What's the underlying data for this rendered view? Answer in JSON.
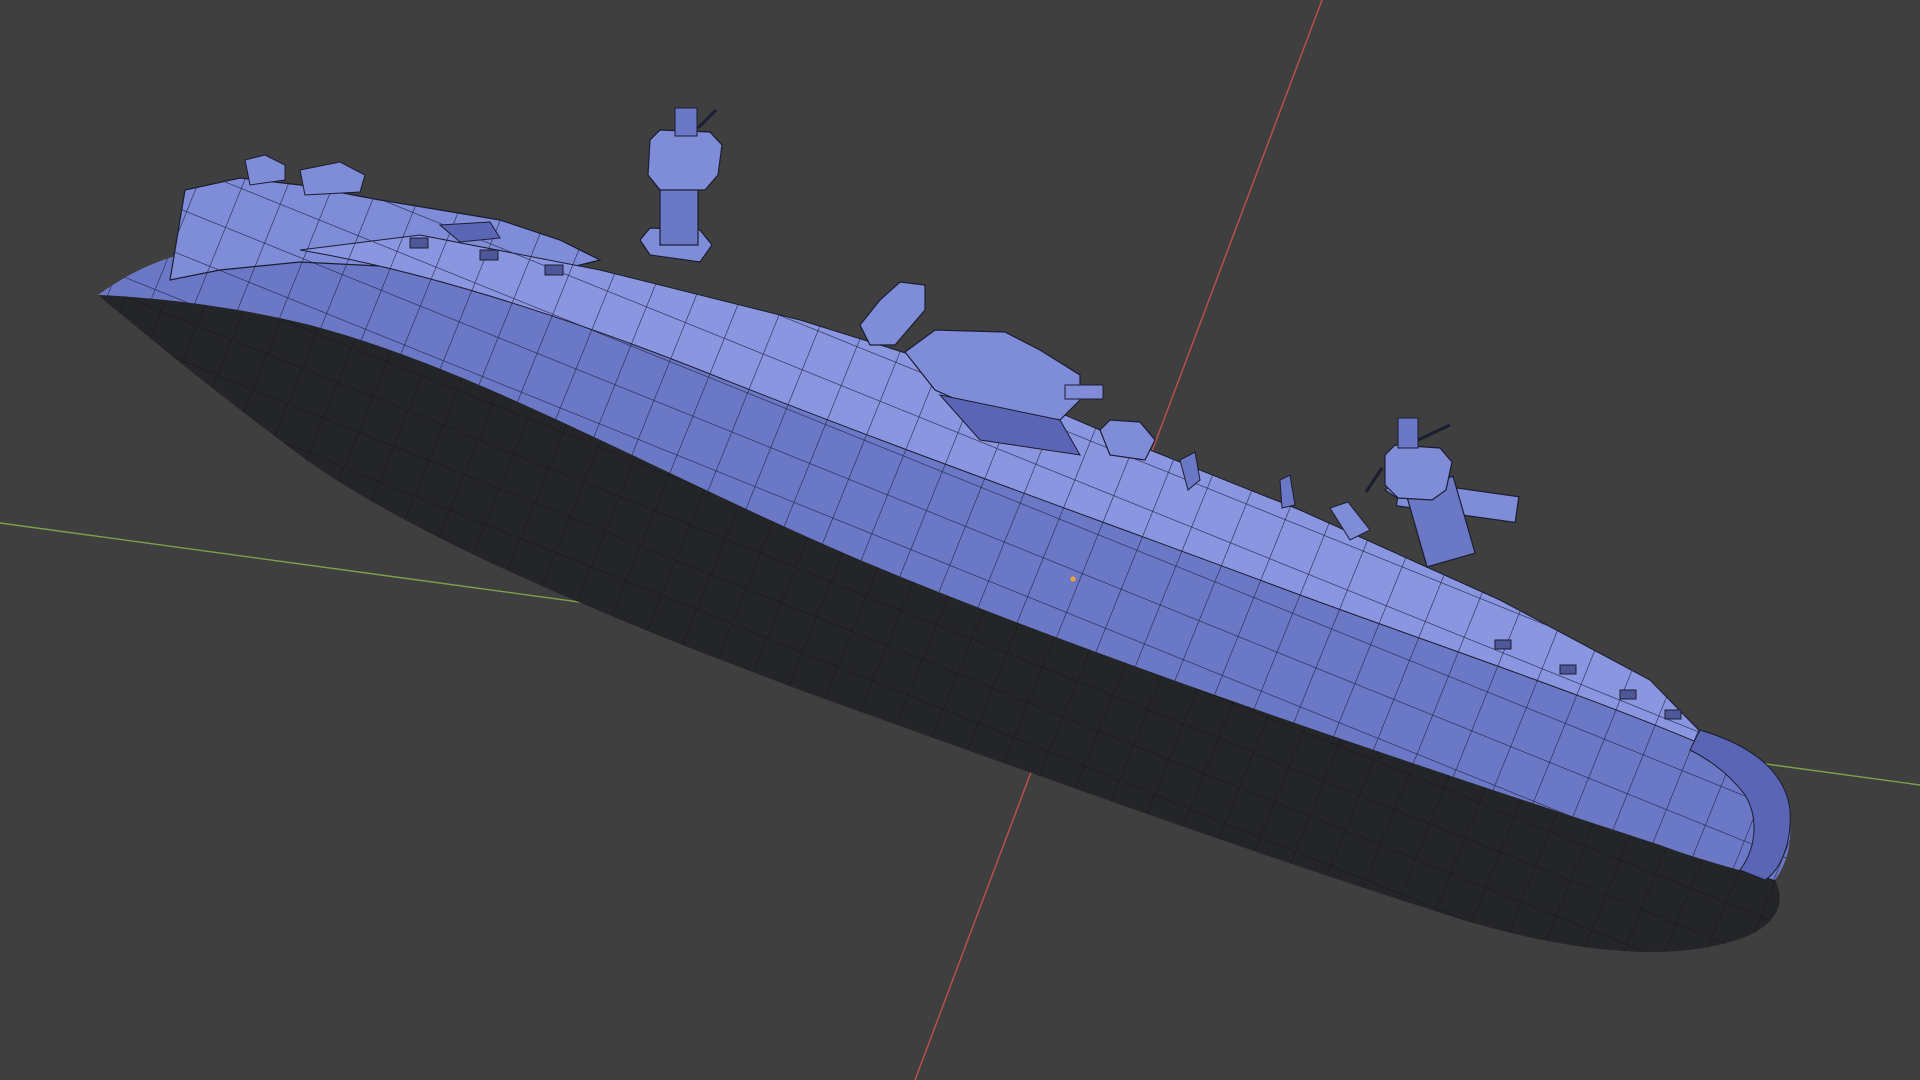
{
  "viewport": {
    "mode": "wireframe-solid",
    "background_color": "#3f3f3f",
    "x_axis_color": "#c0504f",
    "y_axis_color": "#7ea04a",
    "mesh_hull_color": "#6b78c6",
    "mesh_light_color": "#7f8cd8",
    "mesh_dark_color": "#4e5797",
    "mesh_underside_color": "#242529",
    "wire_color": "#1b1d30",
    "origin_color": "#e8a43a"
  },
  "object": {
    "name": "ship-hull",
    "parts": [
      "hull",
      "deck-superstructure",
      "front-funnel",
      "rear-funnel",
      "bridge-tower",
      "deck-cannons"
    ]
  }
}
